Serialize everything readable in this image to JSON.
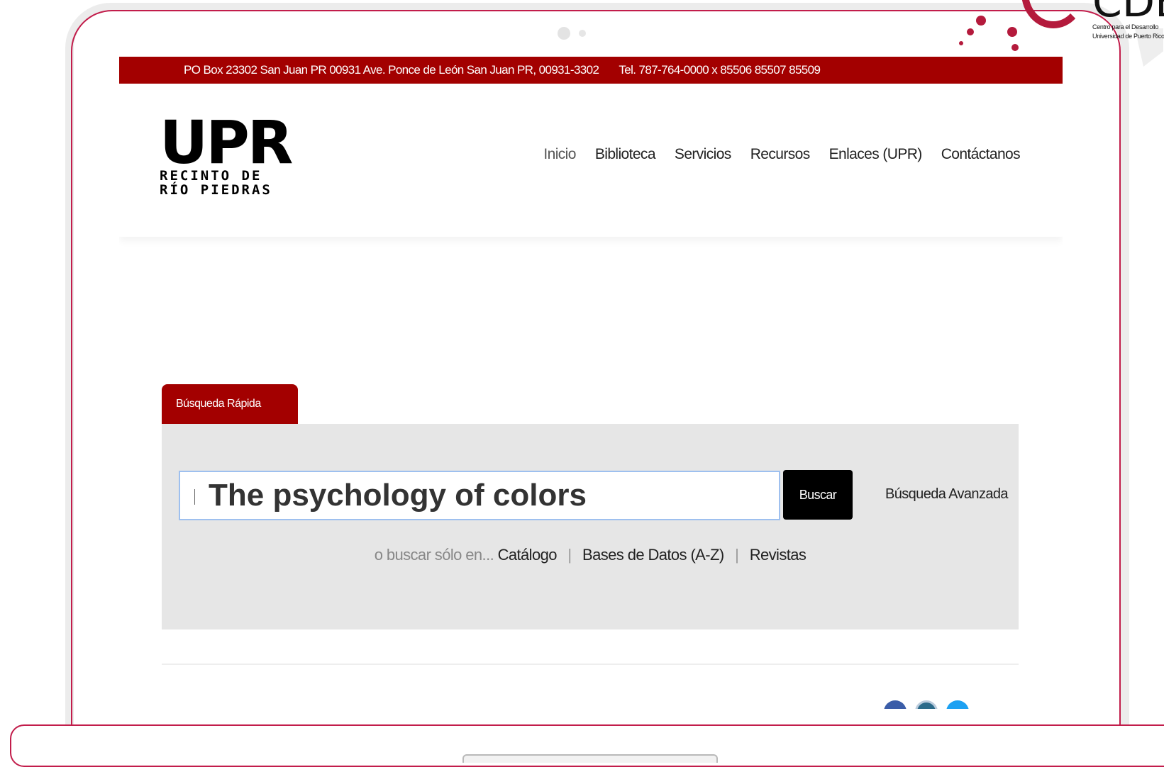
{
  "topbar": {
    "address": "PO Box 23302 San Juan PR 00931 Ave. Ponce de León San Juan PR, 00931-3302",
    "phone": "Tel. 787-764-0000 x 85506 85507 85509"
  },
  "logo": {
    "big": "UPR",
    "line1": "RECINTO DE",
    "line2": "RÍO PIEDRAS"
  },
  "nav": {
    "items": [
      {
        "label": "Inicio"
      },
      {
        "label": "Biblioteca"
      },
      {
        "label": "Servicios"
      },
      {
        "label": "Recursos"
      },
      {
        "label": "Enlaces (UPR)"
      },
      {
        "label": "Contáctanos"
      }
    ]
  },
  "search": {
    "tab_label": "Búsqueda Rápida",
    "query": "The psychology of colors",
    "button_label": "Buscar",
    "advanced_label": "Búsqueda Avanzada",
    "scope_prefix": "o buscar sólo en...",
    "scopes": [
      "Catálogo",
      "Bases de Datos (A-Z)",
      "Revistas"
    ],
    "separator": "|"
  },
  "brand": {
    "letters": "CDB",
    "caption_line1": "Centro para el Desarrollo",
    "caption_line2": "Universidad de Puerto Rico"
  },
  "colors": {
    "primary_red": "#a30000",
    "frame_accent": "#c21d4b",
    "panel_gray": "#e6e6e6",
    "input_border": "#9ec0ef"
  },
  "icons": {
    "social": [
      "facebook-icon",
      "instagram-icon",
      "twitter-icon"
    ]
  }
}
